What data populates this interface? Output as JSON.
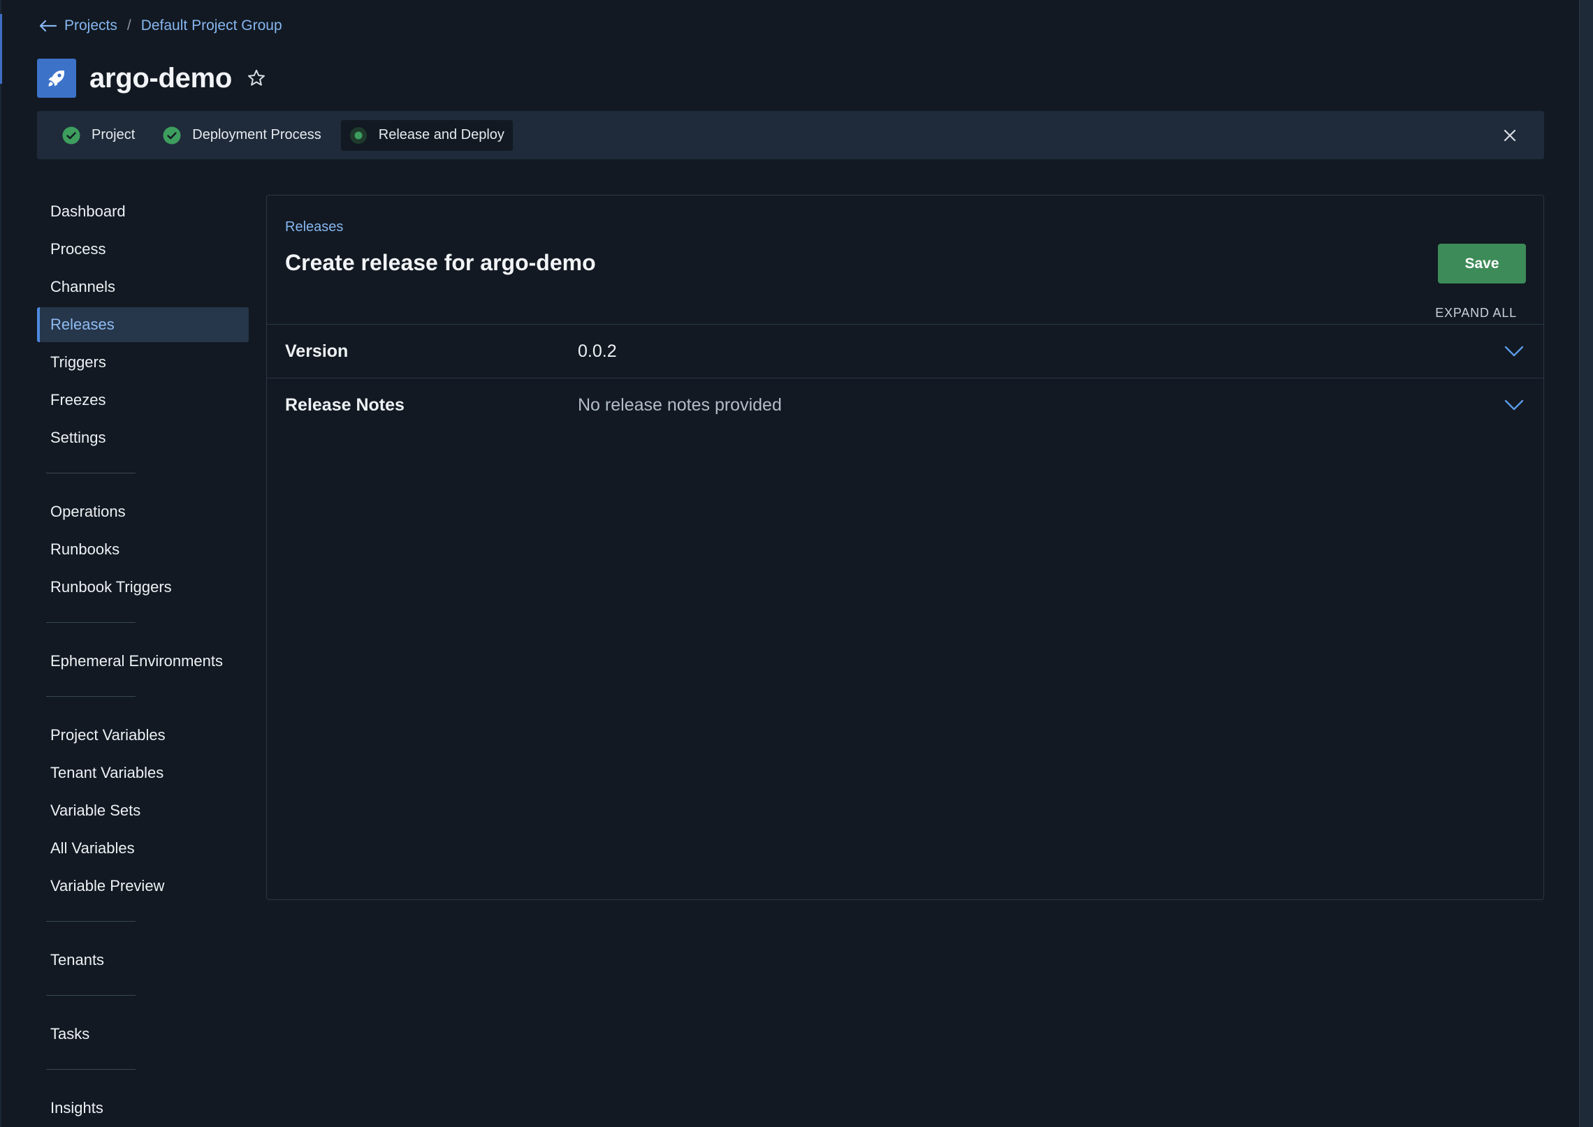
{
  "breadcrumb": {
    "projects": "Projects",
    "separator": "/",
    "group": "Default Project Group"
  },
  "project": {
    "title": "argo-demo",
    "logo_icon": "rocket-icon"
  },
  "stepper": {
    "steps": [
      {
        "label": "Project",
        "status": "complete"
      },
      {
        "label": "Deployment Process",
        "status": "complete"
      },
      {
        "label": "Release and Deploy",
        "status": "current"
      }
    ]
  },
  "sidebar": {
    "items": [
      {
        "label": "Dashboard"
      },
      {
        "label": "Process"
      },
      {
        "label": "Channels"
      },
      {
        "label": "Releases",
        "active": true
      },
      {
        "label": "Triggers"
      },
      {
        "label": "Freezes"
      },
      {
        "label": "Settings"
      },
      {
        "label": "Operations"
      },
      {
        "label": "Runbooks"
      },
      {
        "label": "Runbook Triggers"
      },
      {
        "label": "Ephemeral Environments"
      },
      {
        "label": "Project Variables"
      },
      {
        "label": "Tenant Variables"
      },
      {
        "label": "Variable Sets"
      },
      {
        "label": "All Variables"
      },
      {
        "label": "Variable Preview"
      },
      {
        "label": "Tenants"
      },
      {
        "label": "Tasks"
      },
      {
        "label": "Insights"
      }
    ]
  },
  "main": {
    "breadcrumb": "Releases",
    "title": "Create release for argo-demo",
    "save_label": "Save",
    "expand_all_label": "EXPAND ALL",
    "rows": [
      {
        "label": "Version",
        "value": "0.0.2"
      },
      {
        "label": "Release Notes",
        "value": "No release notes provided"
      }
    ]
  },
  "colors": {
    "background": "#121922",
    "accent": "#86b6f0",
    "save": "#3d8b58",
    "step_complete": "#3d9e5e"
  }
}
